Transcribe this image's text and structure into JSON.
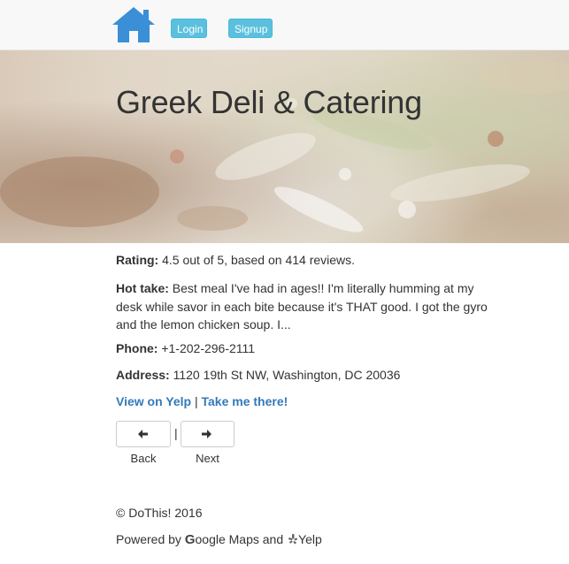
{
  "navbar": {
    "home_icon": "home-icon",
    "home_icon_color": "#3a8fd6",
    "login_label": "Login",
    "signup_label": "Signup",
    "button_color": "#5bc0de"
  },
  "hero": {
    "title": "Greek Deli & Catering"
  },
  "details": {
    "rating_label": "Rating:",
    "rating_value": "4.5 out of 5, based on 414 reviews.",
    "hottake_label": "Hot take:",
    "hottake_value": "Best meal I've had in ages!! I'm literally humming at my desk while savor in each bite because it's THAT good. I got the gyro and the lemon chicken soup. I...",
    "phone_label": "Phone:",
    "phone_value": "+1-202-296-2111",
    "address_label": "Address:",
    "address_value": "1120 19th St NW, Washington, DC 20036",
    "yelp_link": "View on Yelp",
    "separator": "|",
    "directions_link": "Take me there!",
    "link_color": "#337ab7"
  },
  "pager": {
    "back_label": "Back",
    "back_icon": "arrow-left-icon",
    "separator": "|",
    "next_label": "Next",
    "next_icon": "arrow-right-icon"
  },
  "footer": {
    "copyright": "© DoThis! 2016",
    "powered_by": "Powered by",
    "google_g": "G",
    "google_rest": "oogle Maps and",
    "yelp_text": "Yelp"
  }
}
